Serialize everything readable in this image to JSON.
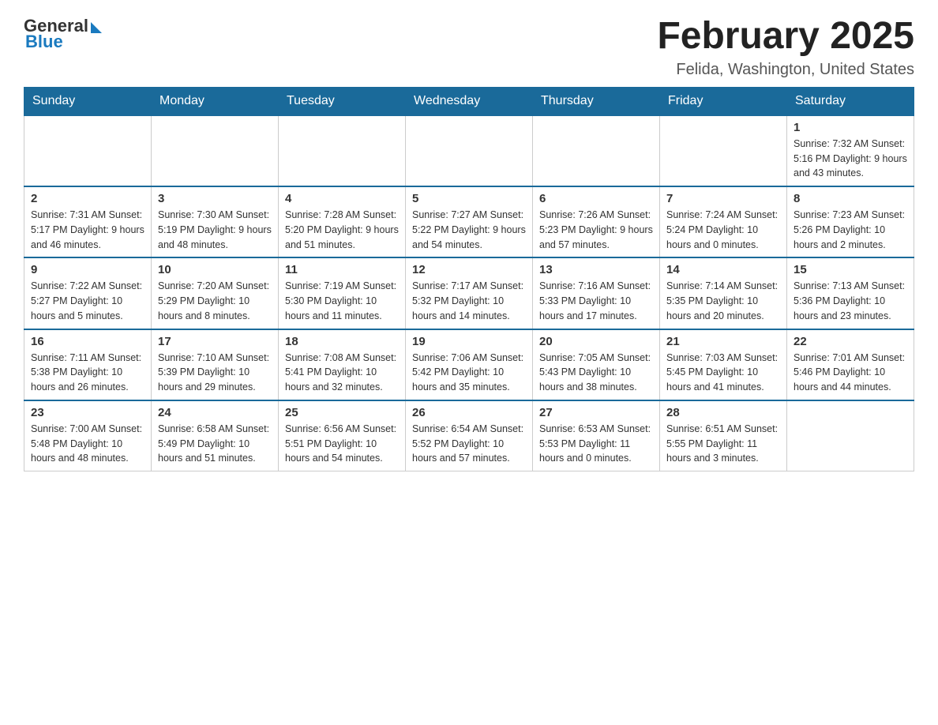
{
  "header": {
    "logo_general": "General",
    "logo_blue": "Blue",
    "month_title": "February 2025",
    "location": "Felida, Washington, United States"
  },
  "calendar": {
    "days_of_week": [
      "Sunday",
      "Monday",
      "Tuesday",
      "Wednesday",
      "Thursday",
      "Friday",
      "Saturday"
    ],
    "weeks": [
      [
        {
          "day": "",
          "info": ""
        },
        {
          "day": "",
          "info": ""
        },
        {
          "day": "",
          "info": ""
        },
        {
          "day": "",
          "info": ""
        },
        {
          "day": "",
          "info": ""
        },
        {
          "day": "",
          "info": ""
        },
        {
          "day": "1",
          "info": "Sunrise: 7:32 AM\nSunset: 5:16 PM\nDaylight: 9 hours and 43 minutes."
        }
      ],
      [
        {
          "day": "2",
          "info": "Sunrise: 7:31 AM\nSunset: 5:17 PM\nDaylight: 9 hours and 46 minutes."
        },
        {
          "day": "3",
          "info": "Sunrise: 7:30 AM\nSunset: 5:19 PM\nDaylight: 9 hours and 48 minutes."
        },
        {
          "day": "4",
          "info": "Sunrise: 7:28 AM\nSunset: 5:20 PM\nDaylight: 9 hours and 51 minutes."
        },
        {
          "day": "5",
          "info": "Sunrise: 7:27 AM\nSunset: 5:22 PM\nDaylight: 9 hours and 54 minutes."
        },
        {
          "day": "6",
          "info": "Sunrise: 7:26 AM\nSunset: 5:23 PM\nDaylight: 9 hours and 57 minutes."
        },
        {
          "day": "7",
          "info": "Sunrise: 7:24 AM\nSunset: 5:24 PM\nDaylight: 10 hours and 0 minutes."
        },
        {
          "day": "8",
          "info": "Sunrise: 7:23 AM\nSunset: 5:26 PM\nDaylight: 10 hours and 2 minutes."
        }
      ],
      [
        {
          "day": "9",
          "info": "Sunrise: 7:22 AM\nSunset: 5:27 PM\nDaylight: 10 hours and 5 minutes."
        },
        {
          "day": "10",
          "info": "Sunrise: 7:20 AM\nSunset: 5:29 PM\nDaylight: 10 hours and 8 minutes."
        },
        {
          "day": "11",
          "info": "Sunrise: 7:19 AM\nSunset: 5:30 PM\nDaylight: 10 hours and 11 minutes."
        },
        {
          "day": "12",
          "info": "Sunrise: 7:17 AM\nSunset: 5:32 PM\nDaylight: 10 hours and 14 minutes."
        },
        {
          "day": "13",
          "info": "Sunrise: 7:16 AM\nSunset: 5:33 PM\nDaylight: 10 hours and 17 minutes."
        },
        {
          "day": "14",
          "info": "Sunrise: 7:14 AM\nSunset: 5:35 PM\nDaylight: 10 hours and 20 minutes."
        },
        {
          "day": "15",
          "info": "Sunrise: 7:13 AM\nSunset: 5:36 PM\nDaylight: 10 hours and 23 minutes."
        }
      ],
      [
        {
          "day": "16",
          "info": "Sunrise: 7:11 AM\nSunset: 5:38 PM\nDaylight: 10 hours and 26 minutes."
        },
        {
          "day": "17",
          "info": "Sunrise: 7:10 AM\nSunset: 5:39 PM\nDaylight: 10 hours and 29 minutes."
        },
        {
          "day": "18",
          "info": "Sunrise: 7:08 AM\nSunset: 5:41 PM\nDaylight: 10 hours and 32 minutes."
        },
        {
          "day": "19",
          "info": "Sunrise: 7:06 AM\nSunset: 5:42 PM\nDaylight: 10 hours and 35 minutes."
        },
        {
          "day": "20",
          "info": "Sunrise: 7:05 AM\nSunset: 5:43 PM\nDaylight: 10 hours and 38 minutes."
        },
        {
          "day": "21",
          "info": "Sunrise: 7:03 AM\nSunset: 5:45 PM\nDaylight: 10 hours and 41 minutes."
        },
        {
          "day": "22",
          "info": "Sunrise: 7:01 AM\nSunset: 5:46 PM\nDaylight: 10 hours and 44 minutes."
        }
      ],
      [
        {
          "day": "23",
          "info": "Sunrise: 7:00 AM\nSunset: 5:48 PM\nDaylight: 10 hours and 48 minutes."
        },
        {
          "day": "24",
          "info": "Sunrise: 6:58 AM\nSunset: 5:49 PM\nDaylight: 10 hours and 51 minutes."
        },
        {
          "day": "25",
          "info": "Sunrise: 6:56 AM\nSunset: 5:51 PM\nDaylight: 10 hours and 54 minutes."
        },
        {
          "day": "26",
          "info": "Sunrise: 6:54 AM\nSunset: 5:52 PM\nDaylight: 10 hours and 57 minutes."
        },
        {
          "day": "27",
          "info": "Sunrise: 6:53 AM\nSunset: 5:53 PM\nDaylight: 11 hours and 0 minutes."
        },
        {
          "day": "28",
          "info": "Sunrise: 6:51 AM\nSunset: 5:55 PM\nDaylight: 11 hours and 3 minutes."
        },
        {
          "day": "",
          "info": ""
        }
      ]
    ]
  }
}
